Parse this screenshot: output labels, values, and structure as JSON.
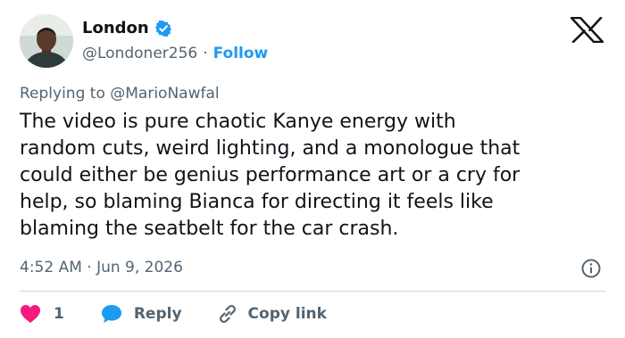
{
  "author": {
    "name": "London",
    "handle": "@Londoner256",
    "separator": "·",
    "follow_label": "Follow",
    "verified_color": "#1d9bf0"
  },
  "reply_to": {
    "prefix": "Replying to ",
    "mention": "@MarioNawfal"
  },
  "tweet": {
    "text": "The video is pure chaotic Kanye energy with\nrandom cuts, weird lighting, and a monologue that\ncould either be genius performance art or a cry for\nhelp, so blaming Bianca for directing it feels like\nblaming the seatbelt for the car crash.",
    "timestamp": "4:52 AM · Jun 9, 2026"
  },
  "actions": {
    "like_count": "1",
    "reply_label": "Reply",
    "copy_label": "Copy link"
  },
  "colors": {
    "accent": "#1d9bf0",
    "like": "#f91880",
    "secondary_text": "#536471"
  },
  "icons": [
    "verified-badge-icon",
    "x-logo-icon",
    "info-icon",
    "heart-icon",
    "reply-bubble-icon",
    "link-icon"
  ]
}
